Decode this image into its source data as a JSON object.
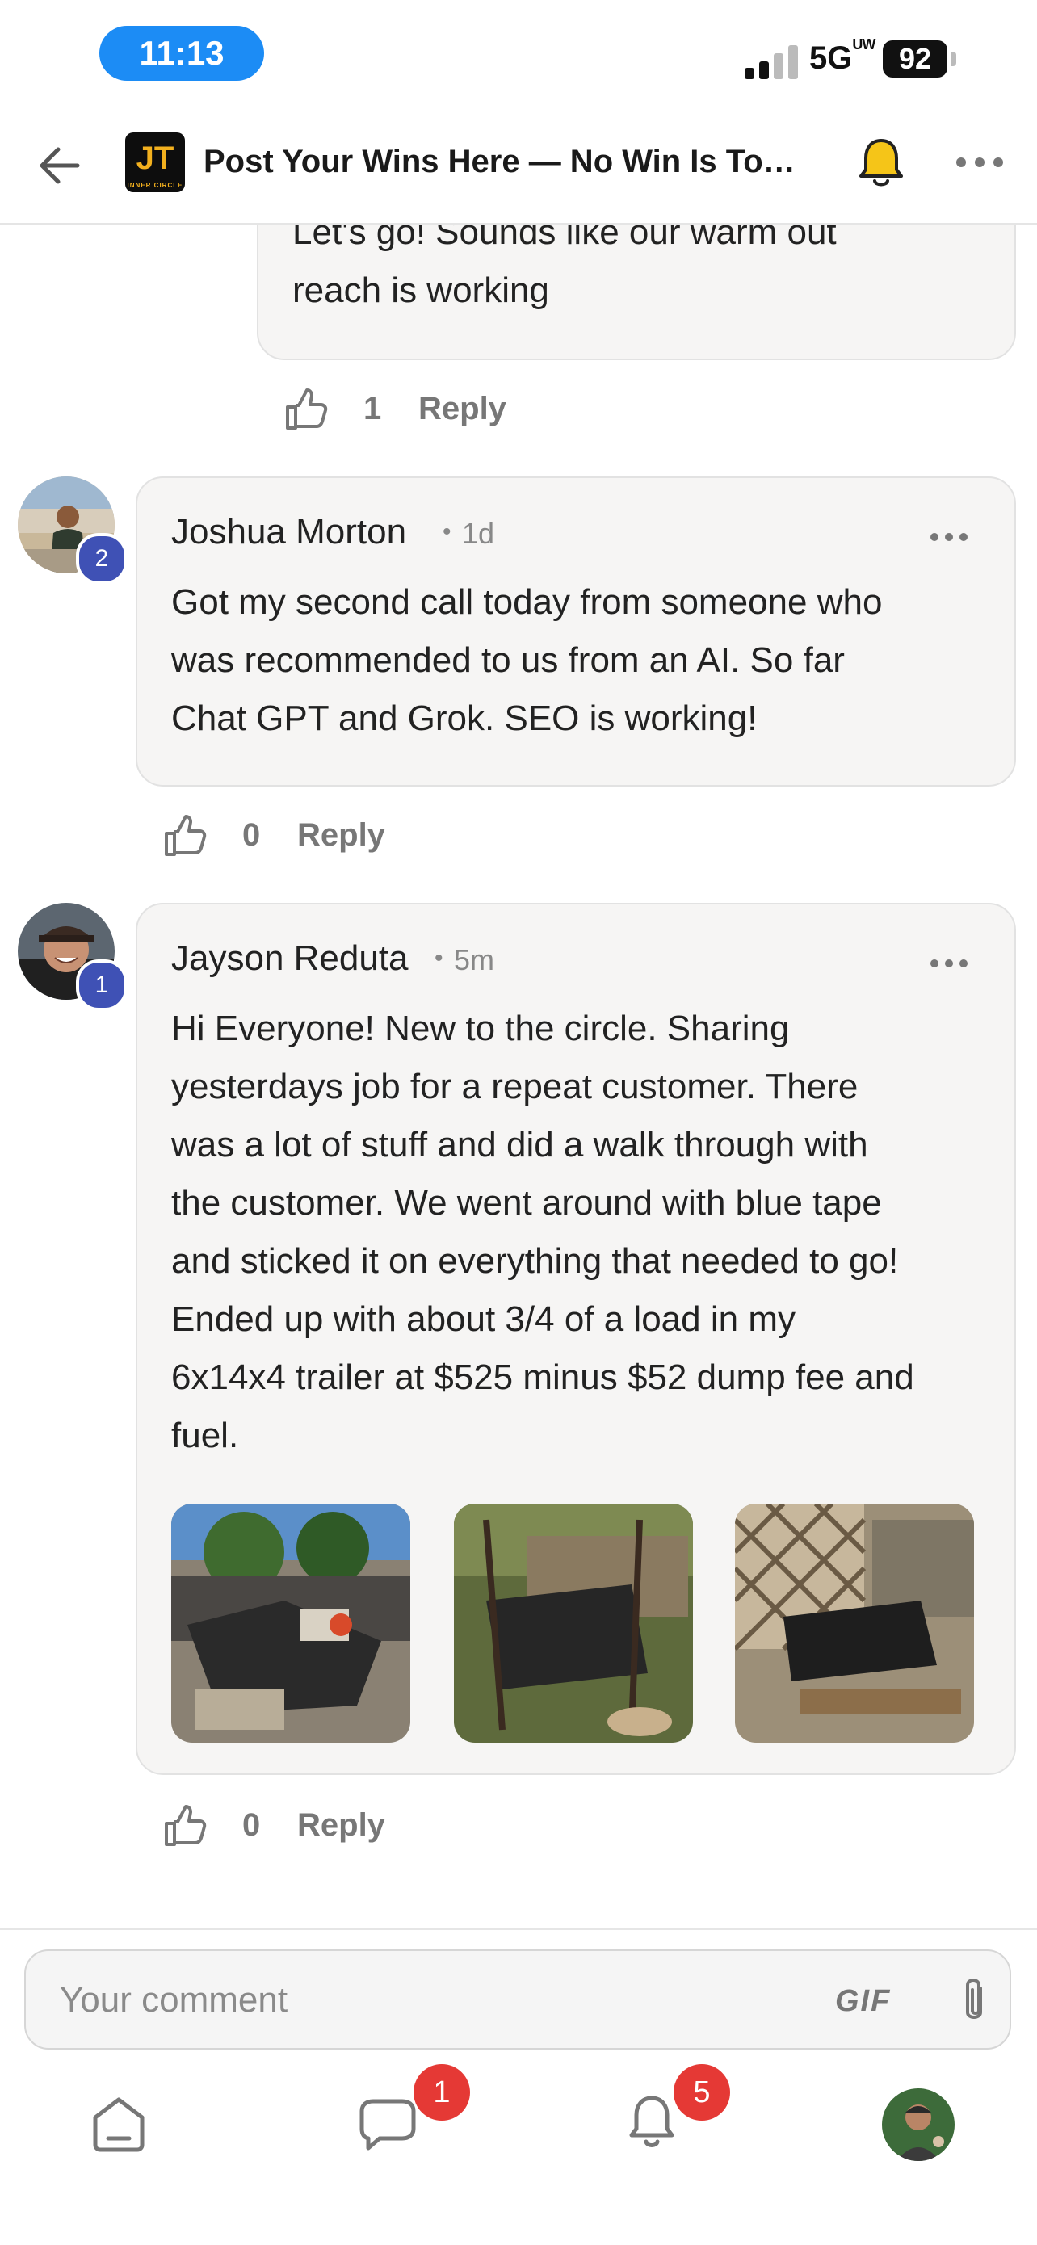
{
  "status_bar": {
    "time": "11:13",
    "network": "5G",
    "network_sup": "UW",
    "battery": "92"
  },
  "header": {
    "title": "Post Your Wins Here — No Win Is Too ...",
    "logo_text": "JT",
    "logo_sub": "INNER CIRCLE"
  },
  "comments": [
    {
      "text_lines": [
        "Let's go! Sounds like our warm out",
        "reach is working"
      ],
      "likes": "1",
      "reply_label": "Reply"
    },
    {
      "author": "Joshua Morton",
      "time": "1d",
      "badge": "2",
      "text_lines": [
        "Got my second call today from someone who",
        "was recommended to us from an AI. So far",
        "Chat GPT and Grok. SEO is working!"
      ],
      "likes": "0",
      "reply_label": "Reply"
    },
    {
      "author": "Jayson Reduta",
      "time": "5m",
      "badge": "1",
      "text_lines": [
        "Hi Everyone! New to the circle. Sharing",
        "yesterdays job for a repeat customer. There",
        "was a lot of stuff and did a walk through with",
        "the customer. We went around with blue tape",
        "and sticked it on everything that needed to go!",
        "Ended up with about 3/4 of a load in my",
        "6x14x4 trailer at $525 minus $52 dump fee and",
        "fuel."
      ],
      "likes": "0",
      "reply_label": "Reply"
    }
  ],
  "composer": {
    "placeholder": "Your comment",
    "gif_label": "GIF"
  },
  "bottom_nav": {
    "messages_badge": "1",
    "notifications_badge": "5"
  },
  "colors": {
    "accent_blue": "#1c8cf5",
    "badge_indigo": "#3f51b5",
    "badge_red": "#e53935",
    "bell_yellow": "#f5c518"
  }
}
